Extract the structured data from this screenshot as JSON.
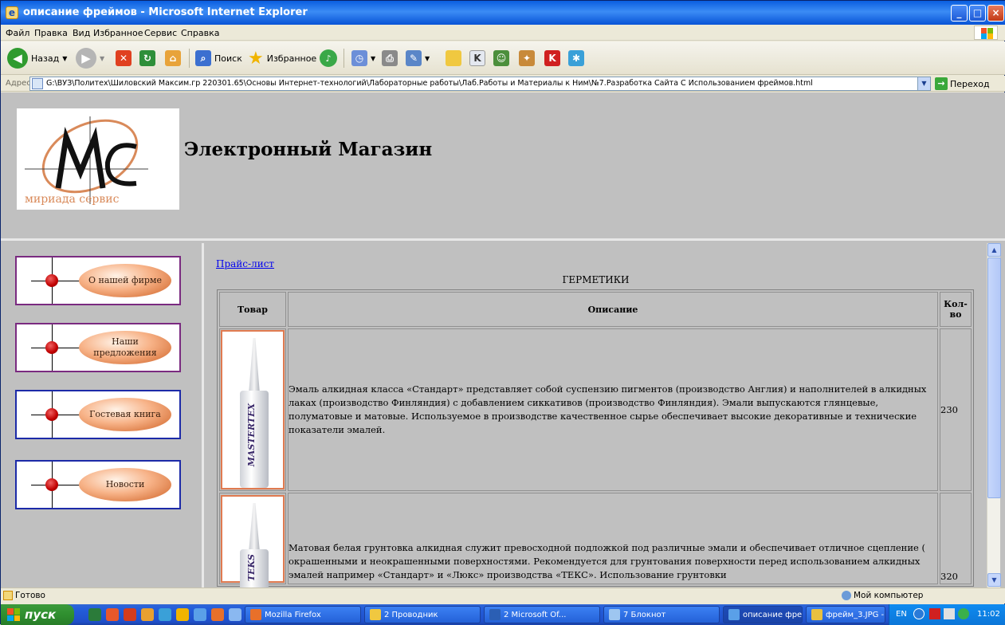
{
  "window": {
    "title": "описание фреймов - Microsoft Internet Explorer",
    "buttons": {
      "minimize": "_",
      "maximize": "□",
      "close": "×"
    }
  },
  "menu": [
    "Файл",
    "Правка",
    "Вид",
    "Избранное",
    "Сервис",
    "Справка"
  ],
  "toolbar": {
    "back_label": "Назад",
    "search_label": "Поиск",
    "favorites_label": "Избранное"
  },
  "address": {
    "label": "Адрес:",
    "url": "G:\\ВУЗ\\Политех\\Шиловский Максим.гр 220301.65\\Основы Интернет-технологий\\Лабораторные работы\\Лаб.Работы и Материалы к Ним\\№7.Разработка Сайта С Использованием фреймов.html",
    "go_label": "Переход"
  },
  "page": {
    "logo_text": "мириада сервис",
    "site_title": "Электронный Магазин",
    "nav": [
      {
        "label": "О нашей фирме"
      },
      {
        "label": "Наши предложения"
      },
      {
        "label": "Гостевая книга"
      },
      {
        "label": "Новости"
      }
    ],
    "price_link": "Прайс-лист",
    "section_title": "ГЕРМЕТИКИ",
    "table": {
      "headers": [
        "Товар",
        "Описание",
        "Кол-во"
      ],
      "rows": [
        {
          "brand": "MASTERTEX",
          "description": "Эмаль алкидная класса «Стандарт» представляет собой суспензию пигментов (производство Англия) и наполнителей в алкидных лаках (производство Финляндия) с добавлением сиккативов (производство Финляндия). Эмали выпускаются глянцевые, полуматовые и матовые. Используемое в производстве качественное сырье обеспечивает высокие декоративные и технические показатели эмалей.",
          "qty": "230"
        },
        {
          "brand": "TEKS",
          "description": "Матовая белая грунтовка алкидная служит превосходной подложкой под различные эмали и обеспечивает отличное сцепление ( окрашенными и неокрашенными поверхностями. Рекомендуется для грунтования поверхности перед использованием алкидных эмалей например «Стандарт» и «Люкс» производства «ТЕКС». Использование грунтовки",
          "qty": "320"
        }
      ]
    }
  },
  "status": {
    "left": "Готово",
    "right": "Мой компьютер"
  },
  "taskbar": {
    "start": "пуск",
    "tasks": [
      {
        "label": "Mozilla Firefox"
      },
      {
        "label": "2 Проводник"
      },
      {
        "label": "2 Microsoft Of..."
      },
      {
        "label": "7 Блокнот"
      },
      {
        "label": "описание фрей..."
      },
      {
        "label": "фрейм_3.JPG - ..."
      }
    ],
    "lang": "EN",
    "clock": "11:02"
  }
}
